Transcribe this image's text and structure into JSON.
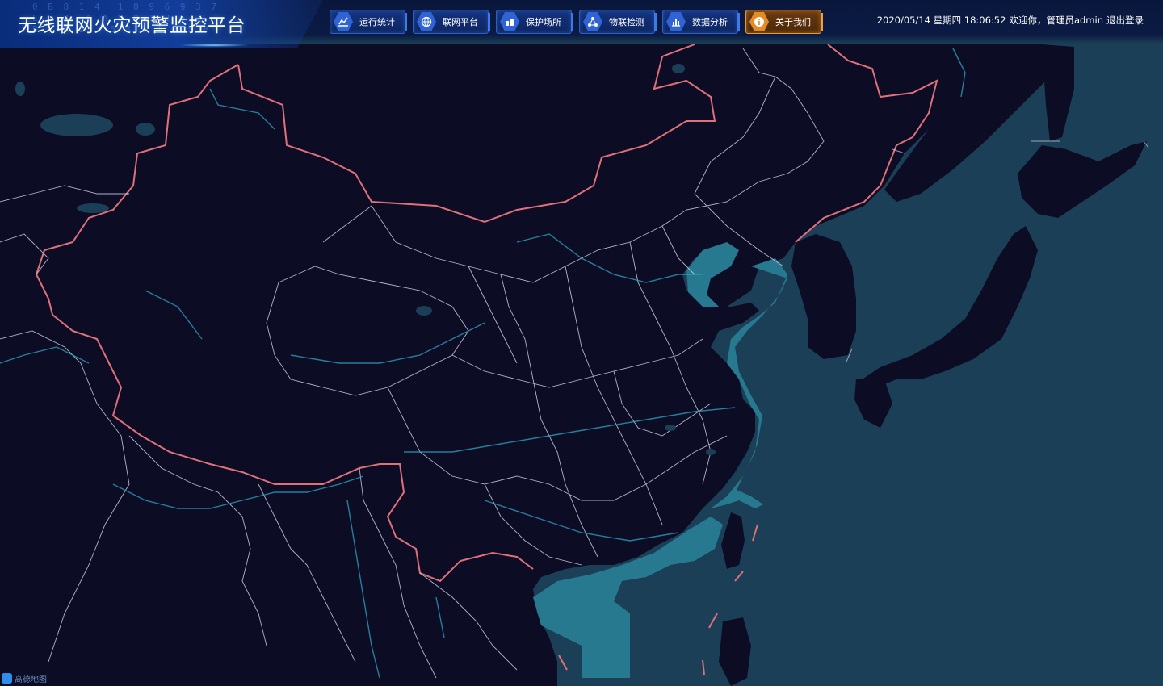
{
  "header": {
    "title": "无线联网火灾预警监控平台",
    "digits_bg": "0 B 8 1 4  1 8 9 6 9 3 7\nE   3  6 A 8 0 1 2 5 7\nB   A 2   5 3 9 1 2 5 8"
  },
  "nav": [
    {
      "label": "运行统计",
      "icon": "chart-line-icon",
      "active": false
    },
    {
      "label": "联网平台",
      "icon": "globe-icon",
      "active": false
    },
    {
      "label": "保护场所",
      "icon": "building-icon",
      "active": false
    },
    {
      "label": "物联检测",
      "icon": "network-icon",
      "active": false
    },
    {
      "label": "数据分析",
      "icon": "bar-chart-icon",
      "active": false
    },
    {
      "label": "关于我们",
      "icon": "info-icon",
      "active": true
    }
  ],
  "status": {
    "datetime": "2020/05/14 星期四 18:06:52",
    "welcome": "欢迎你，管理员admin",
    "logout": "退出登录"
  },
  "map": {
    "provider_logo": "高德地图",
    "colors": {
      "land": "#0c0c24",
      "sea": "#1b3f56",
      "shelf": "#27798f",
      "border": "#e0707a",
      "province": "#cfd3e8",
      "river": "#2ea6c6"
    }
  }
}
